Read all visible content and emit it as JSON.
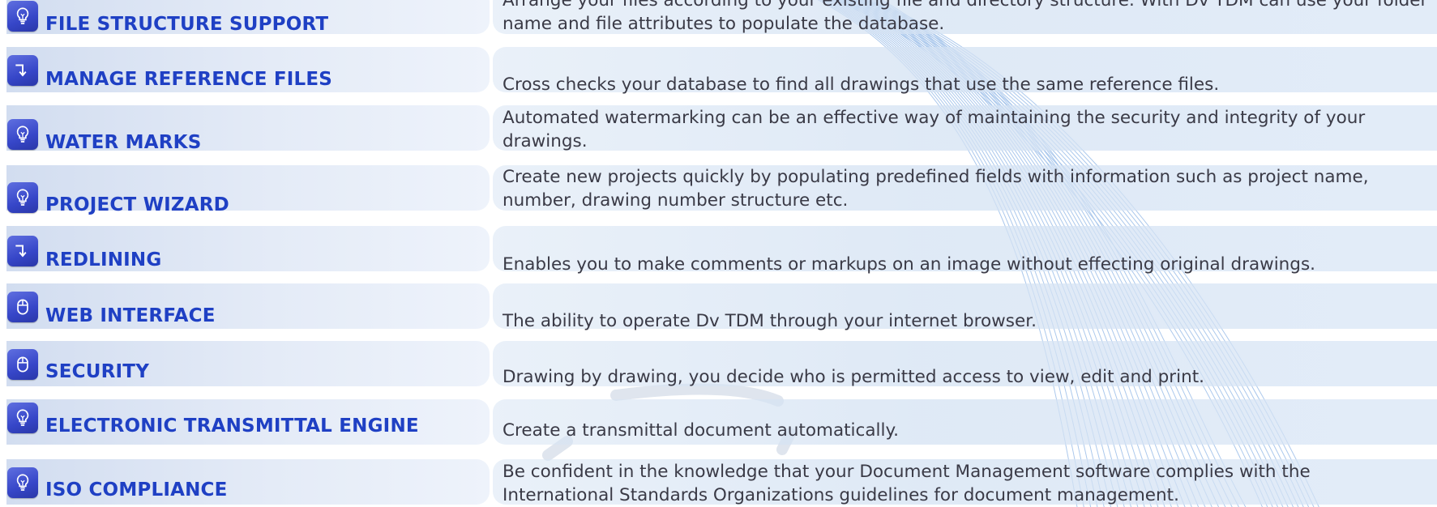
{
  "features": [
    {
      "icon": "lightbulb-icon",
      "label": "FILE STRUCTURE SUPPORT",
      "description": "Arrange your files according to your existing file and directory structure. With Dv TDM can use your folder name and file attributes to populate the database."
    },
    {
      "icon": "arrow-down-icon",
      "label": "MANAGE REFERENCE FILES",
      "description": "Cross checks your database to find all drawings that use the same reference files."
    },
    {
      "icon": "lightbulb-icon",
      "label": "WATER MARKS",
      "description": "Automated watermarking can be an effective way of maintaining the security and integrity of your drawings."
    },
    {
      "icon": "lightbulb-icon",
      "label": "PROJECT WIZARD",
      "description": "Create new projects quickly by populating predefined fields with information such as project name, number, drawing number structure etc."
    },
    {
      "icon": "arrow-down-icon",
      "label": "REDLINING",
      "description": "Enables you to make comments or markups on an image without effecting original drawings."
    },
    {
      "icon": "mouse-icon",
      "label": "WEB INTERFACE",
      "description": "The ability to operate Dv TDM through your internet browser."
    },
    {
      "icon": "mouse-icon",
      "label": "SECURITY",
      "description": "Drawing by drawing, you decide who is permitted access to view, edit and print."
    },
    {
      "icon": "lightbulb-icon",
      "label": "ELECTRONIC TRANSMITTAL ENGINE",
      "description": "Create a transmittal document automatically."
    },
    {
      "icon": "lightbulb-icon",
      "label": "ISO COMPLIANCE",
      "description": "Be confident in the knowledge that your Document Management software complies with the International Standards Organizations guidelines for document management."
    }
  ],
  "colors": {
    "label_text": "#1f40c4",
    "description_text": "#3a3a46",
    "icon_fill": "#3646c8",
    "swirl_lines": "#8fb6e6"
  }
}
